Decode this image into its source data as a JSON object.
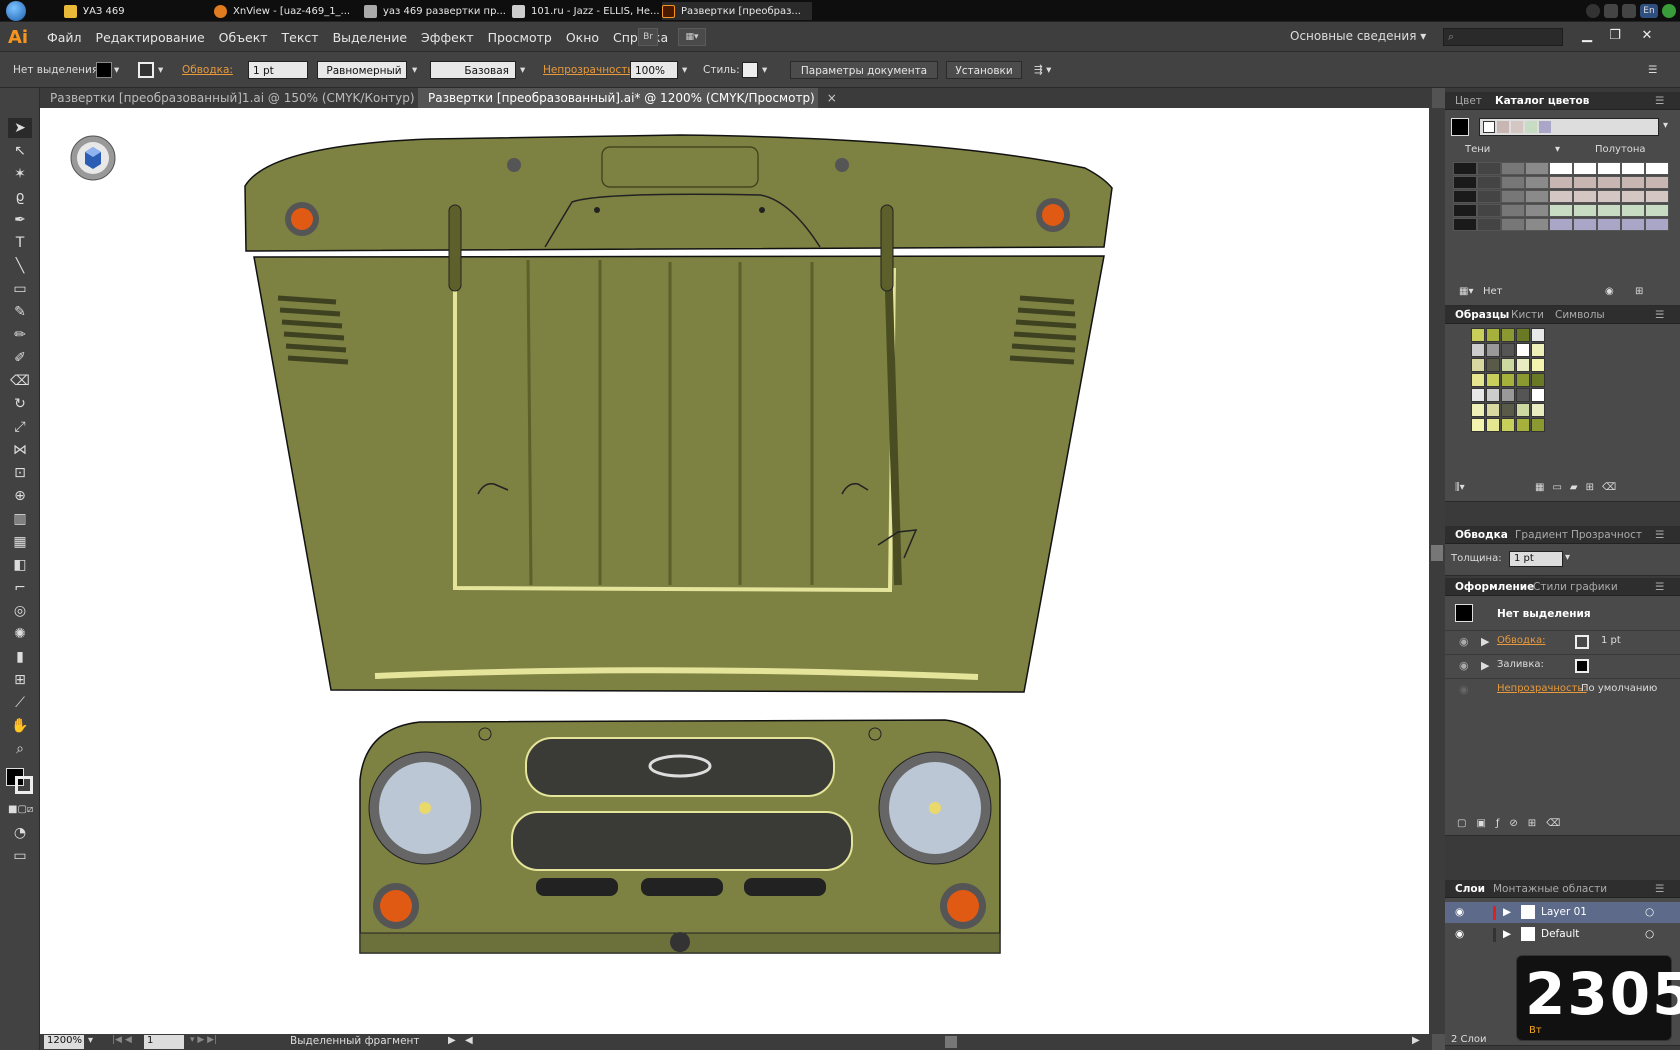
{
  "taskbar": {
    "items": [
      {
        "label": "УАЗ 469",
        "icon": "folder-icon"
      },
      {
        "label": "XnView - [uaz-469_1_...",
        "icon": "xnview-icon"
      },
      {
        "label": "уаз 469 развертки пр...",
        "icon": "document-icon"
      },
      {
        "label": "101.ru - Jazz - ELLIS, He...",
        "icon": "radio-icon"
      },
      {
        "label": "Развертки [преобраз...",
        "icon": "illustrator-icon"
      }
    ],
    "lang": "En"
  },
  "app": {
    "logo": "Ai",
    "menu": [
      "Файл",
      "Редактирование",
      "Объект",
      "Текст",
      "Выделение",
      "Эффект",
      "Просмотр",
      "Окно",
      "Справка"
    ],
    "bridge_label": "Br",
    "workspace": "Основные сведения",
    "search_placeholder": ""
  },
  "control": {
    "selection": "Нет выделения",
    "stroke_label": "Обводка:",
    "stroke_weight": "1 pt",
    "profile": "Равномерный",
    "brush": "Базовая",
    "opacity_label": "Непрозрачность:",
    "opacity": "100%",
    "style_label": "Стиль:",
    "doc_setup": "Параметры документа",
    "prefs": "Установки"
  },
  "tabs": [
    {
      "label": "Развертки [преобразованный]1.ai @ 150% (CMYK/Контур)",
      "active": false
    },
    {
      "label": "Развертки [преобразованный].ai* @ 1200% (CMYK/Просмотр)",
      "active": true
    }
  ],
  "status": {
    "zoom": "1200%",
    "artboard": "1",
    "info": "Выделенный фрагмент"
  },
  "panels": {
    "color": {
      "tabs": [
        "Цвет",
        "Каталог цветов"
      ],
      "shades": "Тени",
      "tints": "Полутона",
      "none_label": "Нет"
    },
    "swatches": {
      "tabs": [
        "Образцы",
        "Кисти",
        "Символы"
      ]
    },
    "stroke": {
      "tabs": [
        "Обводка",
        "Градиент",
        "Прозрачност"
      ],
      "weight_label": "Толщина:",
      "weight": "1 pt"
    },
    "appearance": {
      "tabs": [
        "Оформление",
        "Стили графики"
      ],
      "title": "Нет выделения",
      "stroke_label": "Обводка:",
      "stroke_value": "1 pt",
      "fill_label": "Заливка:",
      "opacity_label": "Непрозрачность:",
      "opacity_value": "По умолчанию"
    },
    "layers": {
      "tabs": [
        "Слои",
        "Монтажные области"
      ],
      "items": [
        "Layer 01",
        "Default"
      ],
      "count": "2 Слои"
    }
  },
  "clock": {
    "time": "2305",
    "weekday": "Вт"
  },
  "colors": {
    "olive": "#7d8142",
    "olive_dark": "#5d602a",
    "panel": "#3a3a3a",
    "accent": "#f7941d"
  }
}
